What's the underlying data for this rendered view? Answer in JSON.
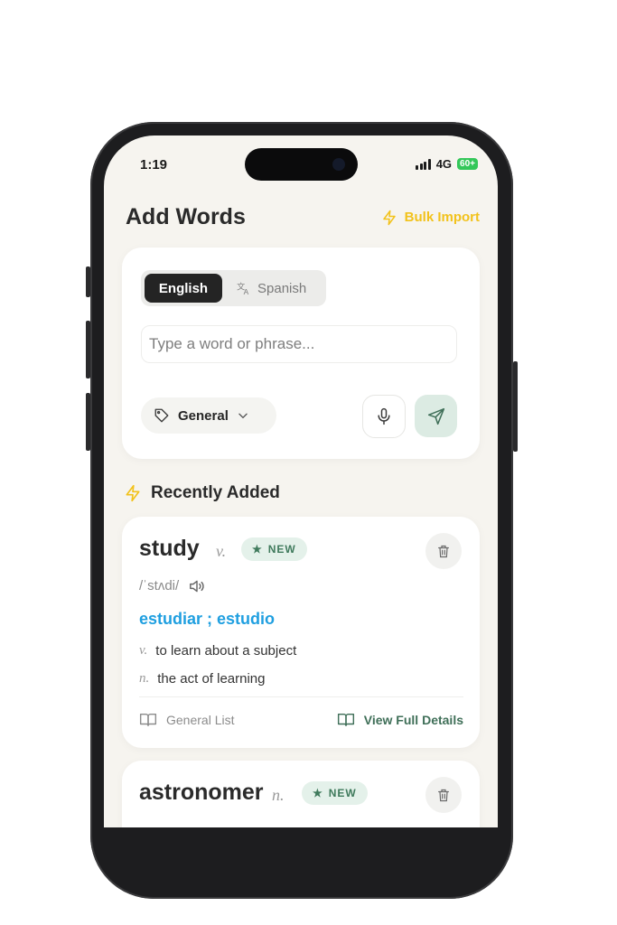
{
  "status": {
    "time": "1:19",
    "network": "4G",
    "battery": "60+"
  },
  "header": {
    "title": "Add Words",
    "bulk_label": "Bulk Import"
  },
  "composer": {
    "languages": [
      "English",
      "Spanish"
    ],
    "input_placeholder": "Type a word or phrase...",
    "input_value": "",
    "category": "General"
  },
  "recent": {
    "title": "Recently Added",
    "words": [
      {
        "word": "study",
        "pos": "v.",
        "badge": "NEW",
        "phonetic": "/ˈstʌdi/",
        "translation": "estudiar ; estudio",
        "definitions": [
          {
            "pos": "v.",
            "text": "to learn about a subject"
          },
          {
            "pos": "n.",
            "text": "the act of learning"
          }
        ],
        "list_label": "General List",
        "details_label": "View Full Details"
      },
      {
        "word": "astronomer",
        "pos": "n.",
        "badge": "NEW"
      }
    ]
  },
  "colors": {
    "accent_yellow": "#f2c21b",
    "translation_blue": "#1f9fe0",
    "badge_green": "#3f7a5c",
    "background": "#f6f4ef"
  }
}
